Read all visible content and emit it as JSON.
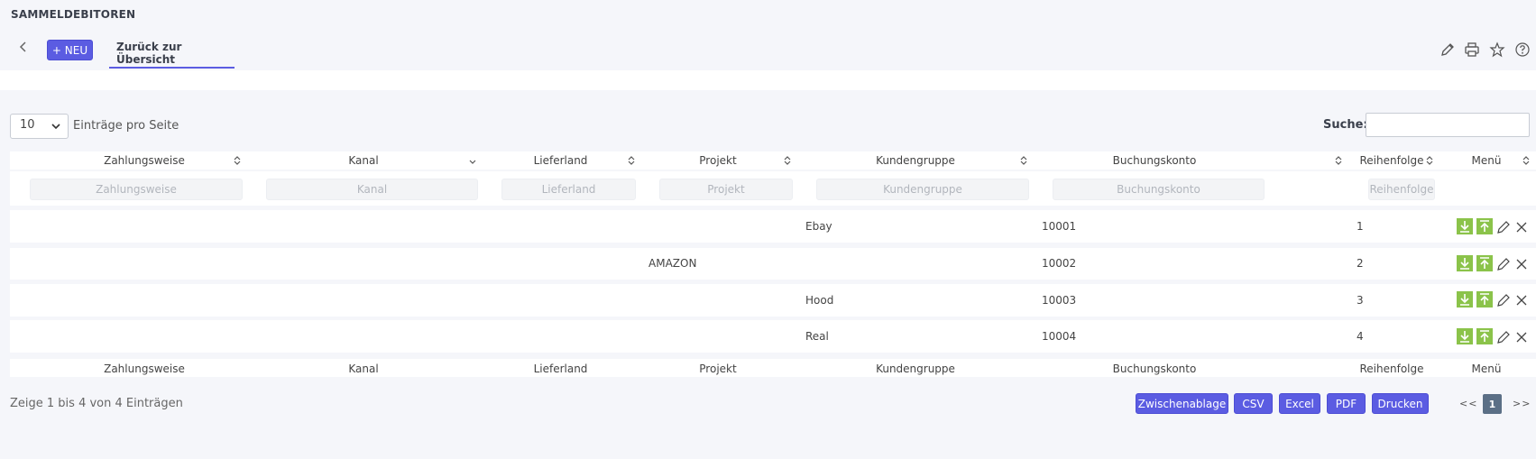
{
  "page": {
    "title": "SAMMELDEBITOREN"
  },
  "toolbar": {
    "new_label": "+ NEU",
    "tab_label": "Zurück zur Übersicht",
    "icons": [
      "edit-icon",
      "print-icon",
      "star-icon",
      "help-icon"
    ]
  },
  "table_controls": {
    "page_length": "10",
    "page_length_label": "Einträge pro Seite",
    "search_label": "Suche:",
    "search_value": ""
  },
  "table": {
    "columns": [
      "Zahlungsweise",
      "Kanal",
      "Lieferland",
      "Projekt",
      "Kundengruppe",
      "Buchungskonto",
      "Reihenfolge",
      "Menü"
    ],
    "filters": [
      "Zahlungsweise",
      "Kanal",
      "Lieferland",
      "Projekt",
      "Kundengruppe",
      "Buchungskonto",
      "Reihenfolge"
    ],
    "rows": [
      {
        "zahlungsweise": "",
        "kanal": "",
        "lieferland": "",
        "projekt": "",
        "kundengruppe": "Ebay",
        "buchungskonto": "10001",
        "reihenfolge": "1"
      },
      {
        "zahlungsweise": "",
        "kanal": "",
        "lieferland": "",
        "projekt": "AMAZON",
        "kundengruppe": "",
        "buchungskonto": "10002",
        "reihenfolge": "2"
      },
      {
        "zahlungsweise": "",
        "kanal": "",
        "lieferland": "",
        "projekt": "",
        "kundengruppe": "Hood",
        "buchungskonto": "10003",
        "reihenfolge": "3"
      },
      {
        "zahlungsweise": "",
        "kanal": "",
        "lieferland": "",
        "projekt": "",
        "kundengruppe": "Real",
        "buchungskonto": "10004",
        "reihenfolge": "4"
      }
    ],
    "row_actions": [
      "move-down-icon",
      "move-up-icon",
      "edit-icon",
      "delete-icon"
    ],
    "colors": {
      "accent": "#5b5ce2",
      "action_green": "#8bc34a",
      "active_page": "#5b6f86"
    }
  },
  "footer": {
    "info": "Zeige 1 bis 4 von 4 Einträgen",
    "export_buttons": [
      "Zwischenablage",
      "CSV",
      "Excel",
      "PDF",
      "Drucken"
    ],
    "pagination": {
      "first": "<<",
      "current": "1",
      "last": ">>"
    }
  }
}
